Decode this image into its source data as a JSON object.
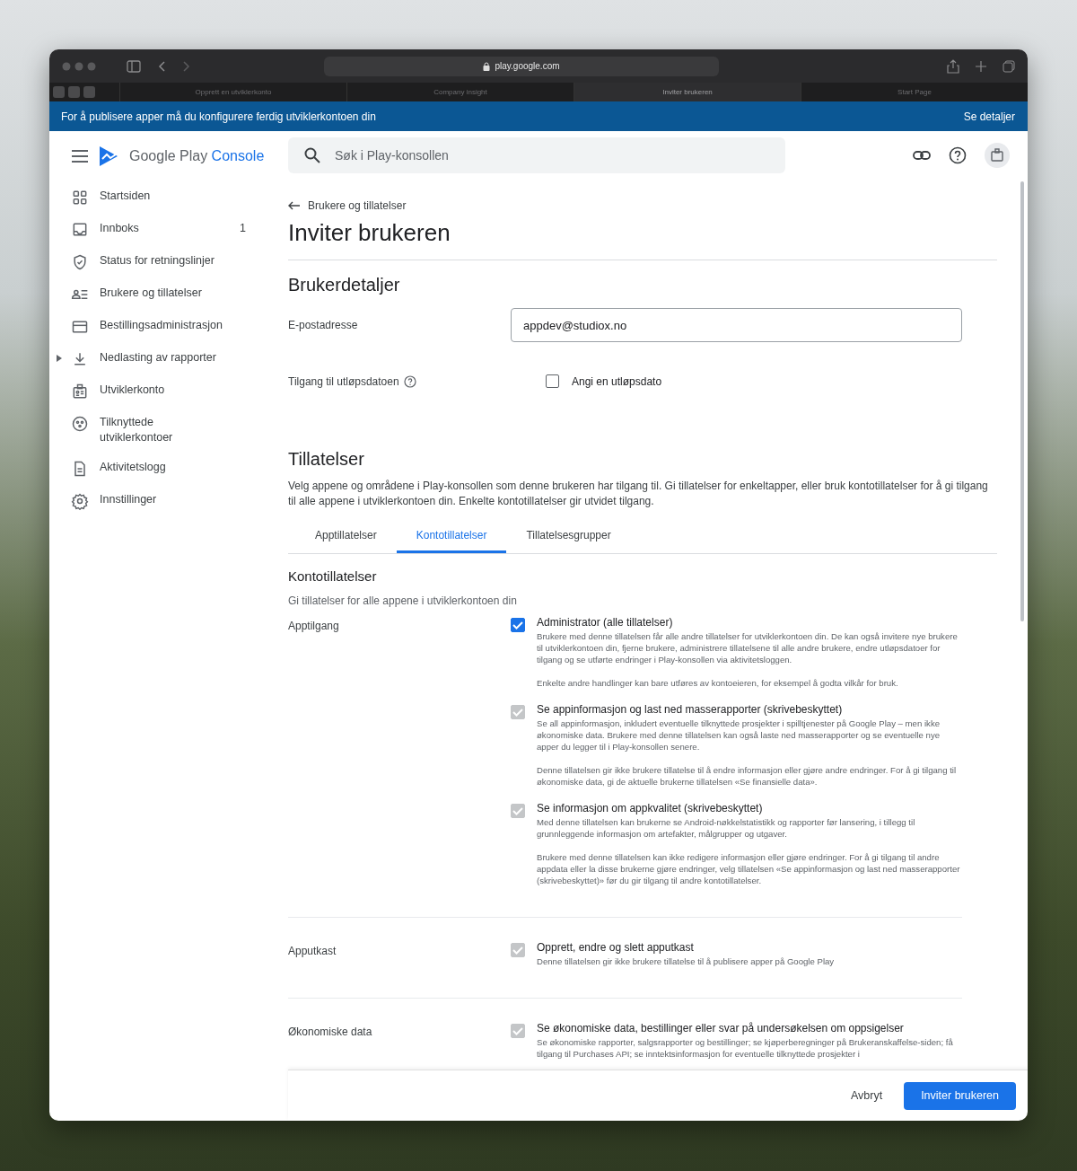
{
  "browser": {
    "url": "play.google.com",
    "tabs": [
      {
        "label": "Opprett en utviklerkonto",
        "selected": false
      },
      {
        "label": "Company insight",
        "selected": false
      },
      {
        "label": "Inviter brukeren",
        "selected": true
      },
      {
        "label": "Start Page",
        "selected": false
      }
    ]
  },
  "banner": {
    "text": "For å publisere apper må du konfigurere ferdig utviklerkontoen din",
    "link": "Se detaljer"
  },
  "header": {
    "logo_main": "Google Play",
    "logo_accent": "Console",
    "search": {
      "placeholder": "Søk i Play-konsollen"
    }
  },
  "sidebar": {
    "items": [
      {
        "label": "Startsiden"
      },
      {
        "label": "Innboks",
        "badge": "1"
      },
      {
        "label": "Status for retningslinjer"
      },
      {
        "label": "Brukere og tillatelser"
      },
      {
        "label": "Bestillingsadministrasjon"
      },
      {
        "label": "Nedlasting av rapporter",
        "expanded": false
      },
      {
        "label": "Utviklerkonto"
      },
      {
        "label": "Tilknyttede utviklerkontoer"
      },
      {
        "label": "Aktivitetslogg"
      },
      {
        "label": "Innstillinger"
      }
    ]
  },
  "breadcrumb": "Brukere og tillatelser",
  "title": "Inviter brukeren",
  "user_details": {
    "heading": "Brukerdetaljer",
    "email_label": "E-postadresse",
    "email_value": "appdev@studiox.no",
    "expiry_label": "Tilgang til utløpsdatoen",
    "expiry_checkbox": {
      "label": "Angi en utløpsdato",
      "checked": false
    }
  },
  "permissions": {
    "heading": "Tillatelser",
    "intro": "Velg appene og områdene i Play-konsollen som denne brukeren har tilgang til. Gi tillatelser for enkeltapper, eller bruk kontotillatelser for å gi tilgang til alle appene i utviklerkontoen din. Enkelte kontotillatelser gir utvidet tilgang.",
    "tabs": [
      {
        "label": "Apptillatelser",
        "selected": false
      },
      {
        "label": "Kontotillatelser",
        "selected": true
      },
      {
        "label": "Tillatelsesgrupper",
        "selected": false
      }
    ],
    "subheading": "Kontotillatelser",
    "subtext": "Gi tillatelser for alle appene i utviklerkontoen din",
    "groups": [
      {
        "label": "Apptilgang",
        "items": [
          {
            "title": "Administrator (alle tillatelser)",
            "checked": true,
            "disabled": false,
            "paragraphs": [
              "Brukere med denne tillatelsen får alle andre tillatelser for utviklerkontoen din. De kan også invitere nye brukere til utviklerkontoen din, fjerne brukere, administrere tillatelsene til alle andre brukere, endre utløpsdatoer for tilgang og se utførte endringer i Play-konsollen via aktivitetsloggen.",
              "Enkelte andre handlinger kan bare utføres av kontoeieren, for eksempel å godta vilkår for bruk."
            ]
          },
          {
            "title": "Se appinformasjon og last ned masserapporter (skrivebeskyttet)",
            "checked": true,
            "disabled": true,
            "paragraphs": [
              "Se all appinformasjon, inkludert eventuelle tilknyttede prosjekter i spilltjenester på Google Play – men ikke økonomiske data. Brukere med denne tillatelsen kan også laste ned masserapporter og se eventuelle nye apper du legger til i Play-konsollen senere.",
              "Denne tillatelsen gir ikke brukere tillatelse til å endre informasjon eller gjøre andre endringer. For å gi tilgang til økonomiske data, gi de aktuelle brukerne tillatelsen «Se finansielle data»."
            ]
          },
          {
            "title": "Se informasjon om appkvalitet (skrivebeskyttet)",
            "checked": true,
            "disabled": true,
            "paragraphs": [
              "Med denne tillatelsen kan brukerne se Android-nøkkelstatistikk og rapporter før lansering, i tillegg til grunnleggende informasjon om artefakter, målgrupper og utgaver.",
              "Brukere med denne tillatelsen kan ikke redigere informasjon eller gjøre endringer. For å gi tilgang til andre appdata eller la disse brukerne gjøre endringer, velg tillatelsen «Se appinformasjon og last ned masserapporter (skrivebeskyttet)» før du gir tilgang til andre kontotillatelser."
            ]
          }
        ]
      },
      {
        "label": "Apputkast",
        "items": [
          {
            "title": "Opprett, endre og slett apputkast",
            "checked": true,
            "disabled": true,
            "paragraphs": [
              "Denne tillatelsen gir ikke brukere tillatelse til å publisere apper på Google Play"
            ]
          }
        ]
      },
      {
        "label": "Økonomiske data",
        "items": [
          {
            "title": "Se økonomiske data, bestillinger eller svar på undersøkelsen om oppsigelser",
            "checked": true,
            "disabled": true,
            "paragraphs": [
              "Se økonomiske rapporter, salgsrapporter og bestillinger; se kjøperberegninger på Brukeranskaffelse-siden; få tilgang til Purchases API; se inntektsinformasjon for eventuelle tilknyttede prosjekter i"
            ]
          }
        ]
      }
    ]
  },
  "footer": {
    "cancel": "Avbryt",
    "submit": "Inviter brukeren"
  }
}
